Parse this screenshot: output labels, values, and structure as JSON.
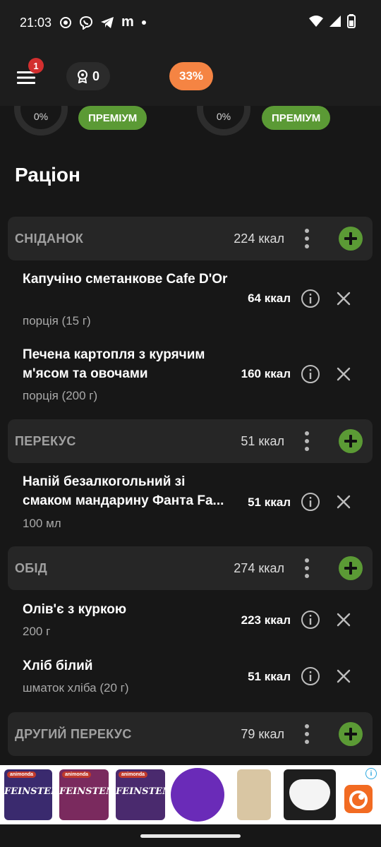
{
  "status_bar": {
    "time": "21:03",
    "icons": [
      "signal-dot-icon",
      "viber-icon",
      "telegram-icon",
      "m-icon",
      "dot-icon"
    ],
    "m_glyph": "m",
    "right_icons": [
      "wifi-icon",
      "cell-signal-icon",
      "battery-icon"
    ]
  },
  "header": {
    "menu_badge": "1",
    "points": "0",
    "progress": "33%"
  },
  "nutrients": {
    "left_percent": "0%",
    "left_button": "ПРЕМІУМ",
    "right_percent": "0%",
    "right_button": "ПРЕМІУМ"
  },
  "section_title": "Раціон",
  "meals": [
    {
      "name": "СНІДАНОК",
      "kcal": "224 ккал",
      "items": [
        {
          "name": "Капучіно сметанкове Cafe D'Or",
          "portion": "порція (15 г)",
          "kcal": "64 ккал"
        },
        {
          "name": "Печена картопля з курячим м'ясом та овочами",
          "portion": "порція (200 г)",
          "kcal": "160 ккал"
        }
      ]
    },
    {
      "name": "ПЕРЕКУС",
      "kcal": "51 ккал",
      "items": [
        {
          "name": "Напій безалкогольний зі смаком мандарину Фанта Fa...",
          "portion": "100 мл",
          "kcal": "51 ккал"
        }
      ]
    },
    {
      "name": "ОБІД",
      "kcal": "274 ккал",
      "items": [
        {
          "name": "Олів'є з куркою",
          "portion": "200 г",
          "kcal": "223 ккал"
        },
        {
          "name": "Хліб білий",
          "portion": "шматок хліба (20 г)",
          "kcal": "51 ккал"
        }
      ]
    },
    {
      "name": "ДРУГИЙ ПЕРЕКУС",
      "kcal": "79 ккал",
      "items": []
    }
  ],
  "ad": {
    "products": [
      {
        "brand": "animonda",
        "label": "FEINSTEN",
        "color": "#3a2a6e"
      },
      {
        "brand": "animonda",
        "label": "FEINSTEN",
        "color": "#7a2a5e"
      },
      {
        "brand": "animonda",
        "label": "FEINSTEN",
        "color": "#4a2a6e"
      }
    ],
    "toy_color": "#6a2bb8",
    "adchoices": "i"
  },
  "colors": {
    "accent_green": "#5b9a35",
    "accent_orange": "#f58443",
    "badge_red": "#d32f2f",
    "background": "#171717",
    "card": "#262626"
  }
}
